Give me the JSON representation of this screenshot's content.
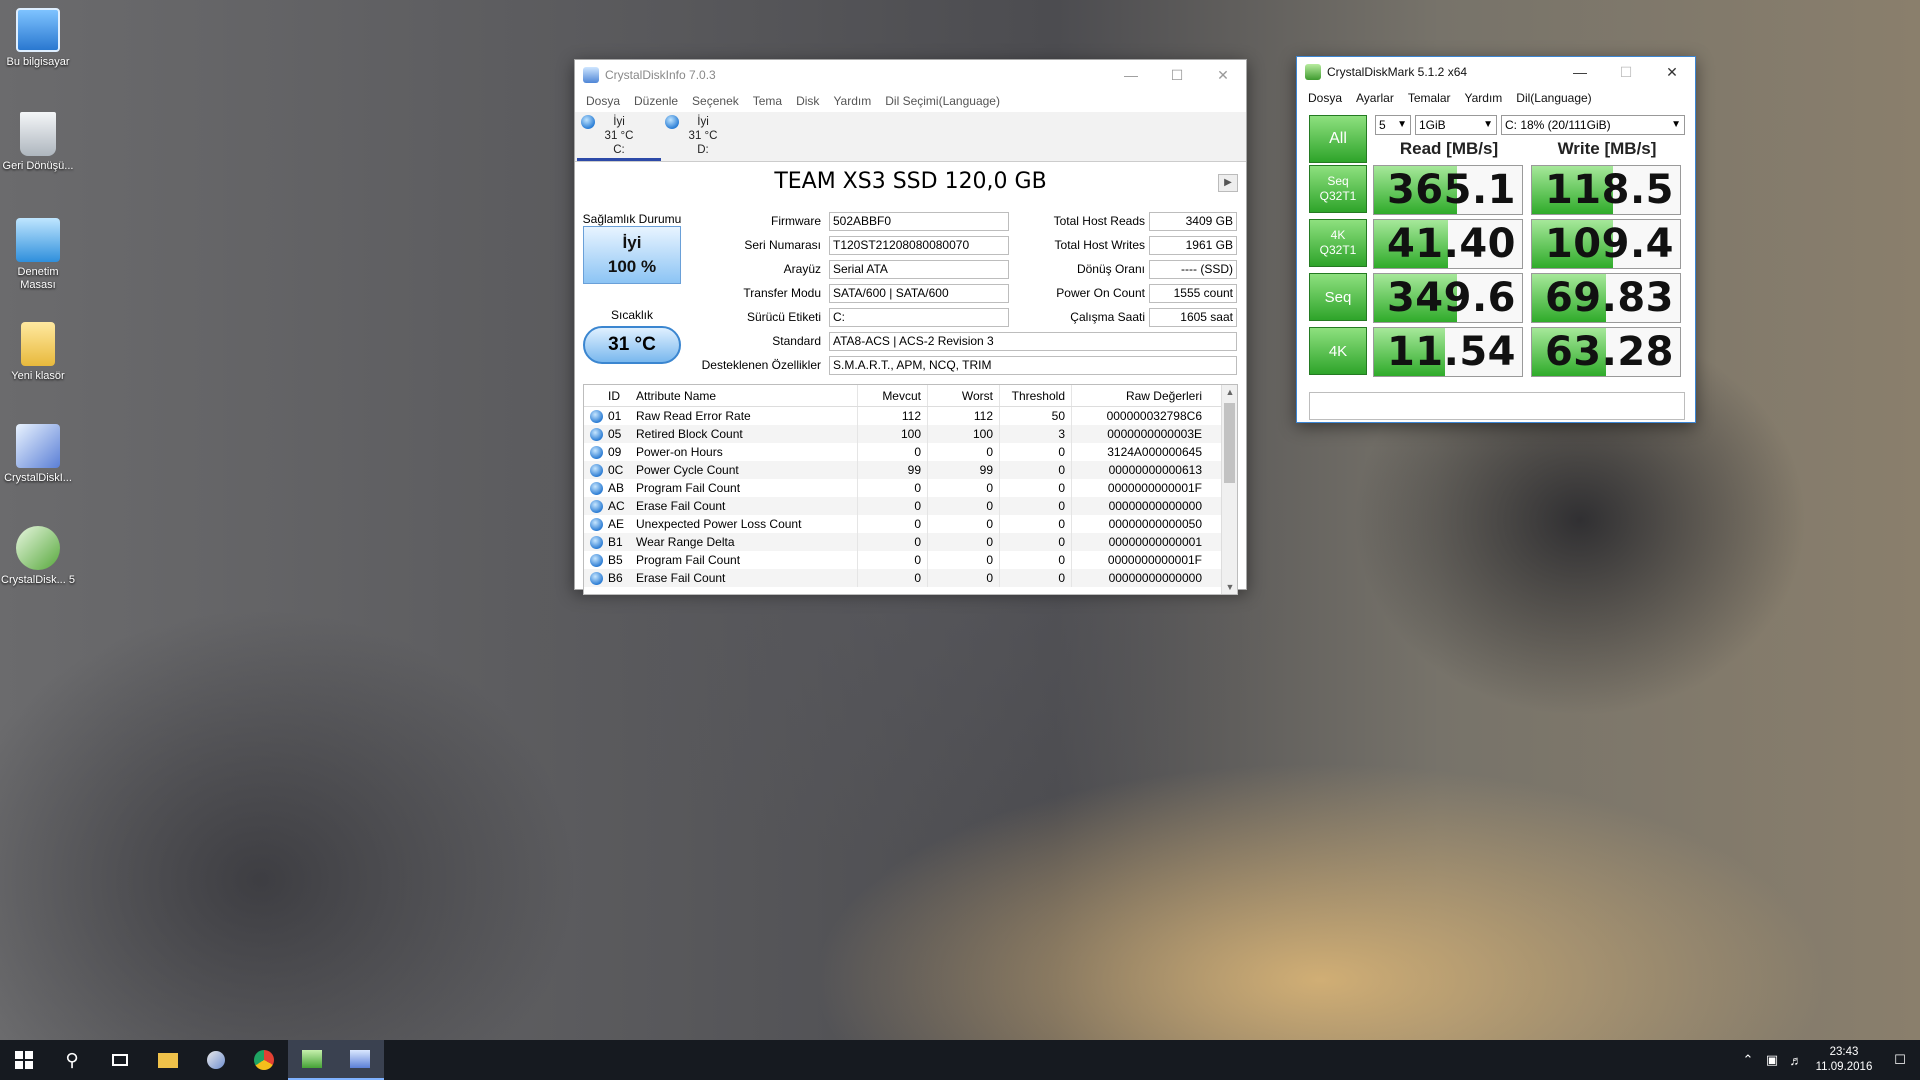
{
  "desktop": {
    "icons": [
      {
        "label": "Bu bilgisayar",
        "color": "#3d8fe0"
      },
      {
        "label": "Geri Dönüşü...",
        "color": "#d8dde2"
      },
      {
        "label": "Denetim Masası",
        "color": "#3aa0e8"
      },
      {
        "label": "Yeni klasör",
        "color": "#f2c94c"
      },
      {
        "label": "CrystalDiskI...",
        "color": "#6d8fd8"
      },
      {
        "label": "CrystalDisk... 5",
        "color": "#8fcc6a"
      }
    ]
  },
  "cdi": {
    "title": "CrystalDiskInfo 7.0.3",
    "menu": [
      "Dosya",
      "Düzenle",
      "Seçenek",
      "Tema",
      "Disk",
      "Yardım",
      "Dil Seçimi(Language)"
    ],
    "drives": [
      {
        "status": "İyi",
        "temp": "31 °C",
        "letter": "C:"
      },
      {
        "status": "İyi",
        "temp": "31 °C",
        "letter": "D:"
      }
    ],
    "model": "TEAM XS3 SSD 120,0 GB",
    "health_label": "Sağlamlık Durumu",
    "health_status": "İyi",
    "health_percent": "100 %",
    "temp_label": "Sıcaklık",
    "temp_value": "31 °C",
    "labels": {
      "firmware": "Firmware",
      "serial": "Seri Numarası",
      "interface": "Arayüz",
      "transfer": "Transfer Modu",
      "drive_letter": "Sürücü Etiketi",
      "standard": "Standard",
      "features": "Desteklenen Özellikler",
      "host_reads": "Total Host Reads",
      "host_writes": "Total Host Writes",
      "rotation": "Dönüş Oranı",
      "power_on_count": "Power On Count",
      "power_on_hours": "Çalışma Saati"
    },
    "values": {
      "firmware": "502ABBF0",
      "serial": "T120ST21208080080070",
      "interface": "Serial ATA",
      "transfer": "SATA/600 | SATA/600",
      "drive_letter": "C:",
      "standard": "ATA8-ACS | ACS-2 Revision 3",
      "features": "S.M.A.R.T., APM, NCQ, TRIM",
      "host_reads": "3409 GB",
      "host_writes": "1961 GB",
      "rotation": "---- (SSD)",
      "power_on_count": "1555 count",
      "power_on_hours": "1605 saat"
    },
    "columns": [
      "ID",
      "Attribute Name",
      "Mevcut",
      "Worst",
      "Threshold",
      "Raw Değerleri"
    ],
    "rows": [
      [
        "01",
        "Raw Read Error Rate",
        "112",
        "112",
        "50",
        "000000032798C6"
      ],
      [
        "05",
        "Retired Block Count",
        "100",
        "100",
        "3",
        "0000000000003E"
      ],
      [
        "09",
        "Power-on Hours",
        "0",
        "0",
        "0",
        "3124A000000645"
      ],
      [
        "0C",
        "Power Cycle Count",
        "99",
        "99",
        "0",
        "00000000000613"
      ],
      [
        "AB",
        "Program Fail Count",
        "0",
        "0",
        "0",
        "0000000000001F"
      ],
      [
        "AC",
        "Erase Fail Count",
        "0",
        "0",
        "0",
        "00000000000000"
      ],
      [
        "AE",
        "Unexpected Power Loss Count",
        "0",
        "0",
        "0",
        "00000000000050"
      ],
      [
        "B1",
        "Wear Range Delta",
        "0",
        "0",
        "0",
        "00000000000001"
      ],
      [
        "B5",
        "Program Fail Count",
        "0",
        "0",
        "0",
        "0000000000001F"
      ],
      [
        "B6",
        "Erase Fail Count",
        "0",
        "0",
        "0",
        "00000000000000"
      ]
    ]
  },
  "cdm": {
    "title": "CrystalDiskMark 5.1.2 x64",
    "menu": [
      "Dosya",
      "Ayarlar",
      "Temalar",
      "Yardım",
      "Dil(Language)"
    ],
    "all_label": "All",
    "count": "5",
    "size": "1GiB",
    "drive": "C: 18% (20/111GiB)",
    "read_header": "Read [MB/s]",
    "write_header": "Write [MB/s]",
    "tests": [
      {
        "line1": "Seq",
        "line2": "Q32T1",
        "read": "365.1",
        "write": "118.5",
        "read_frac": 0.56,
        "write_frac": 0.55
      },
      {
        "line1": "4K",
        "line2": "Q32T1",
        "read": "41.40",
        "write": "109.4",
        "read_frac": 0.5,
        "write_frac": 0.55
      },
      {
        "line1": "Seq",
        "line2": "",
        "read": "349.6",
        "write": "69.83",
        "read_frac": 0.56,
        "write_frac": 0.5
      },
      {
        "line1": "4K",
        "line2": "",
        "read": "11.54",
        "write": "63.28",
        "read_frac": 0.48,
        "write_frac": 0.5
      }
    ]
  },
  "taskbar": {
    "clock_time": "23:43",
    "clock_date": "11.09.2016"
  }
}
